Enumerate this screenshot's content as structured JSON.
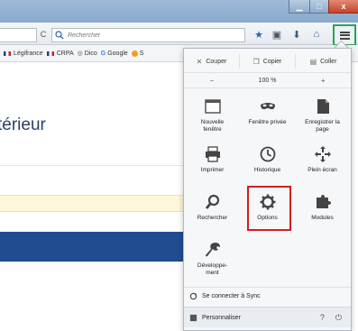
{
  "window": {
    "close_glyph": "x"
  },
  "navbar": {
    "search_placeholder": "Rechercher",
    "reload_glyph": "C"
  },
  "bookmarks": [
    {
      "label": "Légifrance",
      "icon": "flag-fr"
    },
    {
      "label": "CRPA",
      "icon": "flag-fr"
    },
    {
      "label": "Dico",
      "icon": "dico-icon"
    },
    {
      "label": "Google",
      "icon": "google-icon"
    },
    {
      "label": "S",
      "icon": "orange-dot"
    }
  ],
  "page": {
    "heading": "térieur"
  },
  "menu": {
    "edit": {
      "cut": "Couper",
      "copy": "Copier",
      "paste": "Coller"
    },
    "zoom": {
      "minus": "−",
      "value": "100 %",
      "plus": "+"
    },
    "items": {
      "new_window": [
        "Nouvelle",
        "fenêtre"
      ],
      "private_window": "Fenêtre privée",
      "save_page": [
        "Enregistrer la",
        "page"
      ],
      "print": "Imprimer",
      "history": "Historique",
      "fullscreen": "Plein écran",
      "search": "Rechercher",
      "options": "Options",
      "addons": "Modules",
      "developer": [
        "Développe-",
        "ment"
      ]
    },
    "sync": "Se connecter à Sync",
    "customize": "Personnaliser"
  },
  "colors": {
    "highlight_options": "#d01f1f",
    "highlight_menu_button": "#2da44e",
    "blue_band": "#1f4d8f",
    "yellow_band": "#fdf6da"
  }
}
